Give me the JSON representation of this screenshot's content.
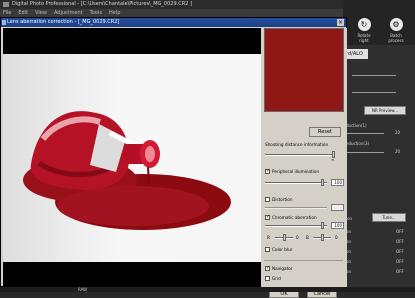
{
  "app": {
    "title": "Digital Photo Professional - [C:\\Users\\Chantale\\Pictures\\_MG_0029.CR2 ]",
    "menu": [
      "File",
      "Edit",
      "View",
      "Adjustment",
      "Tools",
      "Help"
    ],
    "tools": {
      "rotate_right": "Rotate right",
      "batch_process": "Batch process"
    },
    "right_panel": {
      "tab": "rd/ALO",
      "nr_preview": "NR Preview...",
      "reduction_1": "duction(1)",
      "reduction_3": "eduction(3)",
      "value_1": "20",
      "value_2": "20",
      "option": "ion",
      "tune": "Tune...",
      "off": [
        "OFF",
        "OFF",
        "OFF",
        "OFF",
        "OFF"
      ]
    },
    "status": "RAW"
  },
  "dialog": {
    "title": "Lens aberration correction - [_MG_0029.CR2]",
    "reset": "Reset",
    "shooting_distance": "Shooting distance information",
    "infinity": "∞",
    "peripheral_label": "Peripheral illumination",
    "peripheral_value": "100",
    "distortion_label": "Distortion",
    "chromatic_label": "Chromatic aberration",
    "chromatic_value": "100",
    "r_label": "R",
    "r_value": "0",
    "b_label": "B",
    "b_value": "0",
    "color_blur": "Color blur",
    "navigator": "Navigator",
    "grid": "Grid",
    "ok": "OK",
    "cancel": "Cancel",
    "checks": {
      "peripheral": true,
      "distortion": false,
      "chromatic": true,
      "color_blur": false,
      "navigator": true,
      "grid": false
    }
  }
}
